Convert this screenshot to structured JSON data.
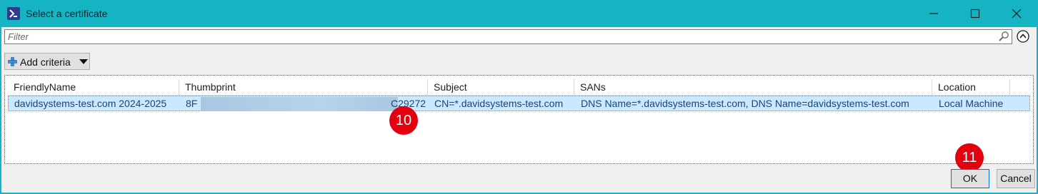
{
  "window": {
    "title": "Select a certificate",
    "icon": "powershell-icon",
    "accent_color": "#15b4c3"
  },
  "filter": {
    "placeholder": "Filter",
    "value": ""
  },
  "toolbar": {
    "add_criteria_label": "Add criteria"
  },
  "grid": {
    "columns": [
      "FriendlyName",
      "Thumbprint",
      "Subject",
      "SANs",
      "Location"
    ],
    "rows": [
      {
        "friendly_name": "davidsystems-test.com 2024-2025",
        "thumbprint_start": "8F",
        "thumbprint_end": "C29272",
        "subject": "CN=*.davidsystems-test.com",
        "sans": "DNS Name=*.davidsystems-test.com, DNS Name=davidsystems-test.com",
        "location": "Local Machine"
      }
    ]
  },
  "annotations": {
    "step_a": "10",
    "step_b": "11"
  },
  "buttons": {
    "ok": "OK",
    "cancel": "Cancel"
  }
}
